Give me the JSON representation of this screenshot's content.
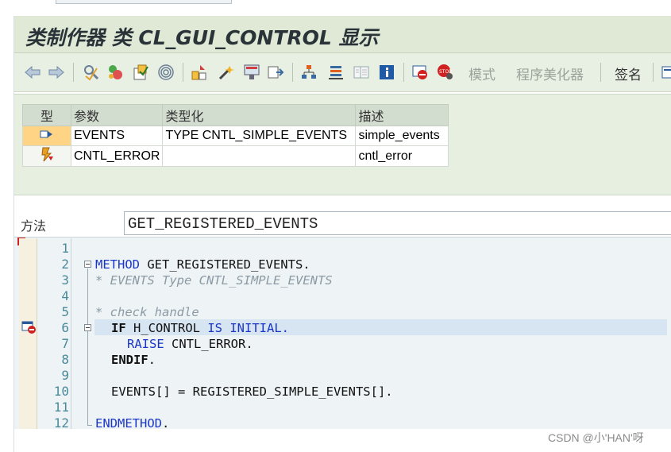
{
  "title": "类制作器 类 CL_GUI_CONTROL 显示",
  "toolbar": {
    "icons": [
      "back-icon",
      "forward-icon",
      "other-object-icon",
      "check-icon",
      "activate-icon",
      "where-used-icon",
      "object-list-icon",
      "change-icon",
      "wizard-icon",
      "enhancement-icon",
      "local-types-icon",
      "hierarchy-icon",
      "stack-icon",
      "docu-icon",
      "info-icon",
      "breakpoint-icon",
      "stop-icon"
    ],
    "mode_label": "模式",
    "pretty_printer_label": "程序美化器",
    "signature_label": "签名"
  },
  "params_table": {
    "headers": [
      "型",
      "参数",
      "类型化",
      "描述"
    ],
    "rows": [
      {
        "icon": "importing-param-icon",
        "name": "EVENTS",
        "typing": "TYPE CNTL_SIMPLE_EVENTS",
        "description": "simple_events"
      },
      {
        "icon": "exception-icon",
        "name": "CNTL_ERROR",
        "typing": "",
        "description": "cntl_error"
      }
    ]
  },
  "method": {
    "label": "方法",
    "name": "GET_REGISTERED_EVENTS"
  },
  "editor": {
    "line_numbers": [
      "1",
      "2",
      "3",
      "4",
      "5",
      "6",
      "7",
      "8",
      "9",
      "10",
      "11",
      "12"
    ],
    "code": {
      "l2_kw": "METHOD",
      "l2_rest": " GET_REGISTERED_EVENTS.",
      "l3": "* EVENTS Type CNTL_SIMPLE_EVENTS",
      "l5": "* check handle",
      "l6_kw1": "IF",
      "l6_mid": " H_CONTROL ",
      "l6_kw2": "IS INITIAL.",
      "l7_kw": "RAISE",
      "l7_rest": " CNTL_ERROR.",
      "l8_kw": "ENDIF",
      "l8_rest": ".",
      "l10": "EVENTS[] = REGISTERED_SIMPLE_EVENTS[].",
      "l12_kw": "ENDMETHOD",
      "l12_rest": "."
    },
    "breakpoint_icon": "session-breakpoint-icon"
  },
  "watermark": "CSDN @小'HAN'呀"
}
